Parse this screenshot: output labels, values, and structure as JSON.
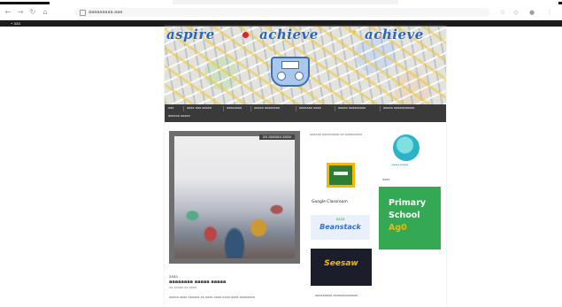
{
  "browser": {
    "url": "aaaaaaaaa.aaa",
    "bookmark_label": "• aaa",
    "icons": {
      "back": "arrow-left-icon",
      "forward": "arrow-right-icon",
      "reload": "reload-icon",
      "home": "home-icon",
      "lock": "lock-icon",
      "star": "star-icon",
      "extension": "puzzle-icon",
      "profile": "profile-icon",
      "menu": "kebab-menu-icon"
    }
  },
  "site": {
    "banner": {
      "words": [
        "aspire",
        "achieve",
        "achieve"
      ],
      "colors": {
        "text": "#2d63b8",
        "heart": "#d8262c",
        "star": "#f2c52a"
      }
    },
    "menu": {
      "items": [
        "aaa",
        "aaaa aaa aaaaa",
        "aaaaaaaa",
        "aaaaa aaaaaaaa",
        "aaaaaaa aaaa",
        "aaaaa aaaaaaaaa",
        "aaaaa aaaaaaaaaaa",
        "aaaaaa aaaaa"
      ]
    },
    "post": {
      "date_badge": "aa aaaaaa aaaa",
      "category": "aaaa",
      "title": "aaaaaaaa aaaaa aaaaa",
      "meta": "aa aaaaa aa aaaa",
      "excerpt": "aaaaa aaaa aaaaaa aa aaaa aaaa aaaa aaaa aaaaaaaa"
    },
    "sidebar_middle": {
      "widget_label": "aaaaaa aaaaaaaaa aa aaaaaaaaa",
      "google_classroom_label": "Google Classroom",
      "beanstack_small": "aaaa",
      "beanstack_large": "Beanstack",
      "seesaw_label": "Seesaw",
      "widget2_label": "aaaaaaaaa aaaaaaaaaaaaa"
    },
    "sidebar_right": {
      "globe_caption": "aaaaa aaaaa",
      "menu_label": "aaaa",
      "tile_lines": [
        "Primary",
        "School",
        "Ag0"
      ],
      "tile_colors": {
        "bg": "#34a853",
        "text": "#ffffff",
        "accent": "#f8b300"
      }
    }
  }
}
